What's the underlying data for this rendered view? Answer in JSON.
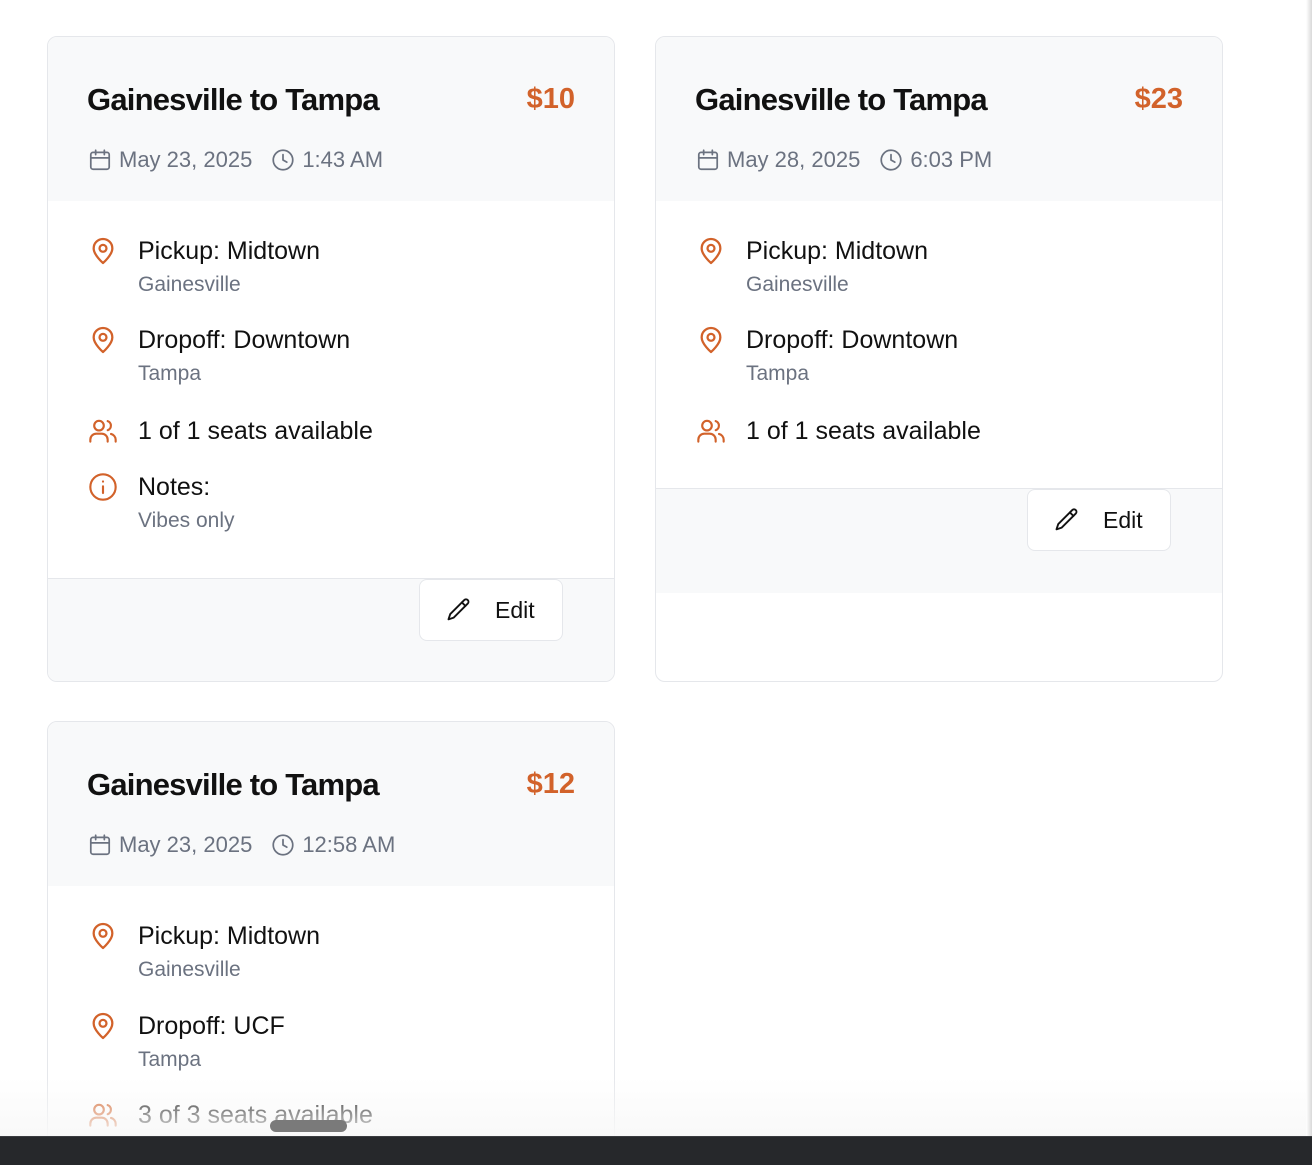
{
  "rides": [
    {
      "title": "Gainesville to Tampa",
      "price": "$10",
      "date": "May 23, 2025",
      "time": "1:43 AM",
      "pickup": "Pickup: Midtown",
      "pickup_city": "Gainesville",
      "dropoff": "Dropoff: Downtown",
      "dropoff_city": "Tampa",
      "seats": "1 of 1 seats available",
      "notes_label": "Notes:",
      "notes": "Vibes only",
      "edit_label": "Edit"
    },
    {
      "title": "Gainesville to Tampa",
      "price": "$23",
      "date": "May 28, 2025",
      "time": "6:03 PM",
      "pickup": "Pickup: Midtown",
      "pickup_city": "Gainesville",
      "dropoff": "Dropoff: Downtown",
      "dropoff_city": "Tampa",
      "seats": "1 of 1 seats available",
      "edit_label": "Edit"
    },
    {
      "title": "Gainesville to Tampa",
      "price": "$12",
      "date": "May 23, 2025",
      "time": "12:58 AM",
      "pickup": "Pickup: Midtown",
      "pickup_city": "Gainesville",
      "dropoff": "Dropoff: UCF",
      "dropoff_city": "Tampa",
      "seats": "3 of 3 seats available"
    }
  ],
  "icons": {
    "date": "calendar-icon",
    "time": "clock-icon",
    "location": "map-pin-icon",
    "seats": "users-icon",
    "notes": "info-icon",
    "edit": "pencil-icon"
  },
  "colors": {
    "accent": "#d2622a",
    "muted_text": "#6b7280",
    "header_bg": "#f8f9fa",
    "border": "#e5e7eb"
  }
}
